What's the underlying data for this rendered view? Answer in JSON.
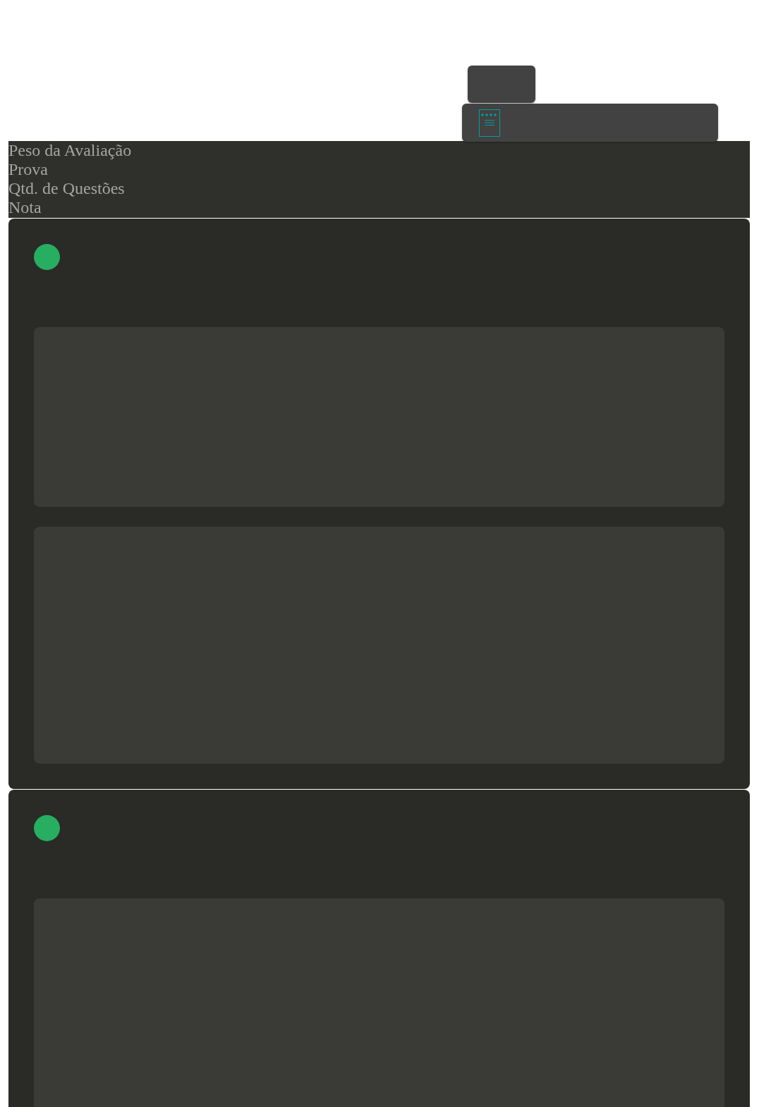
{
  "summary": {
    "labels": [
      "Peso da Avaliação",
      "Prova",
      "Qtd. de Questões",
      "Nota"
    ]
  }
}
